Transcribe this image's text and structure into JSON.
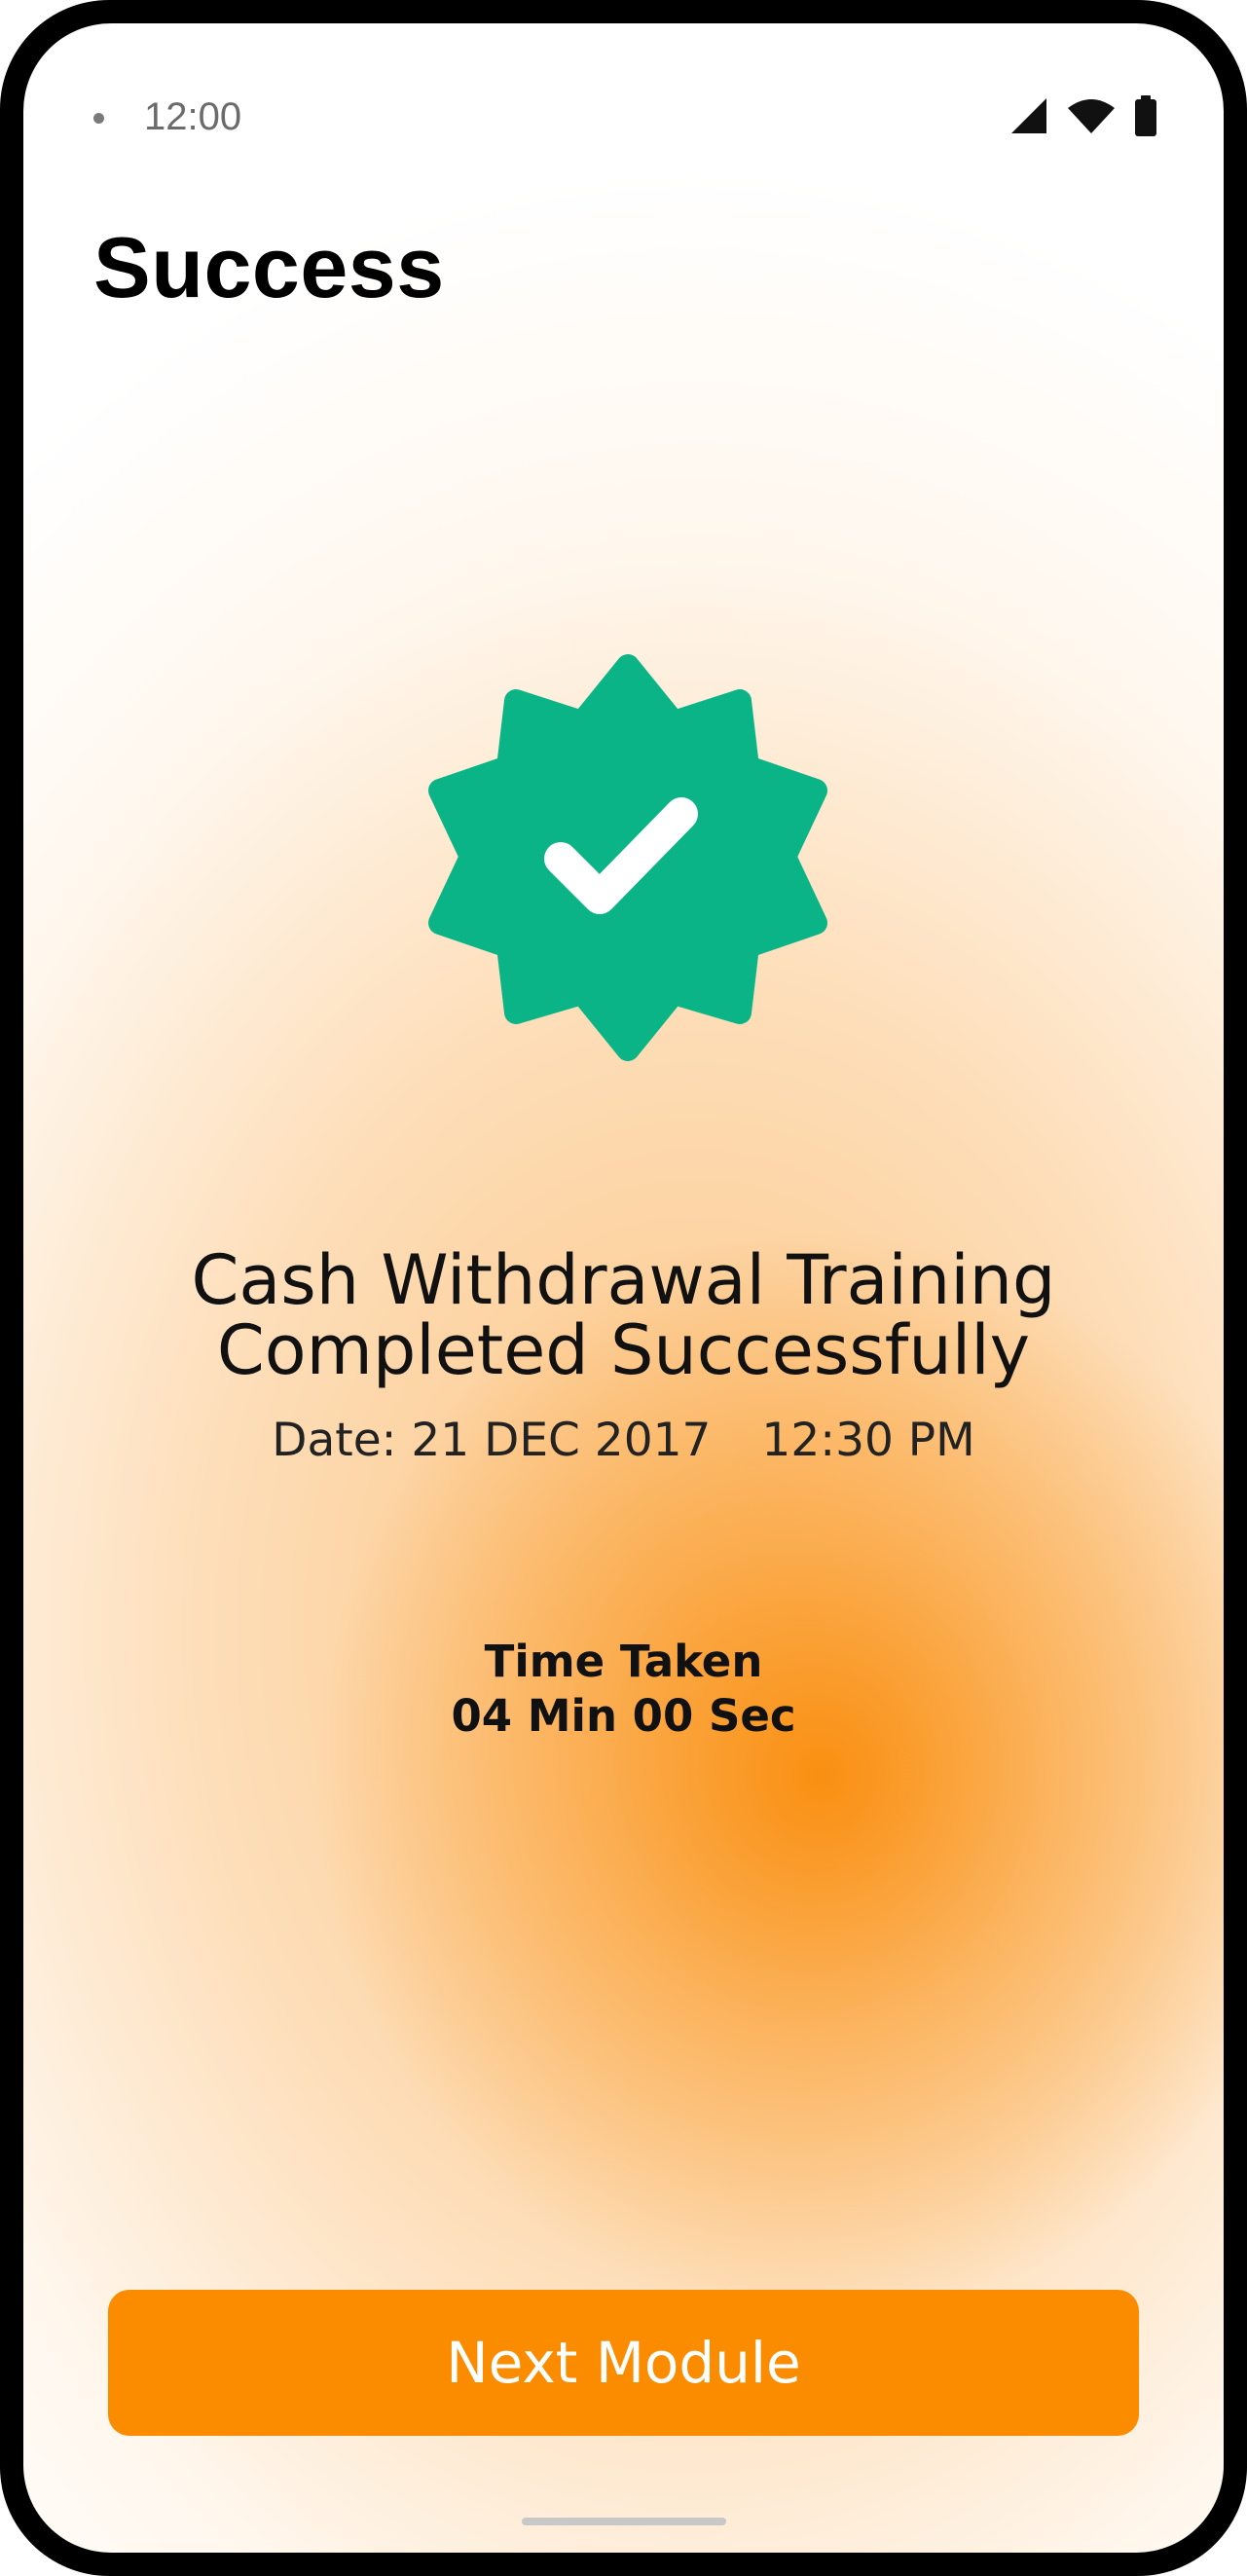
{
  "status_bar": {
    "time": "12:00"
  },
  "header": {
    "title": "Success"
  },
  "badge": {
    "color": "#0bb487",
    "icon": "verified-badge-check-icon"
  },
  "result": {
    "headline_line1": "Cash Withdrawal Training",
    "headline_line2": "Completed Successfully",
    "date": "Date: 21 DEC 2017",
    "time": "12:30 PM"
  },
  "time_taken": {
    "label": "Time Taken",
    "value": "04 Min 00 Sec"
  },
  "actions": {
    "next_label": "Next Module"
  },
  "colors": {
    "accent": "#fb8c00",
    "success": "#0bb487"
  }
}
